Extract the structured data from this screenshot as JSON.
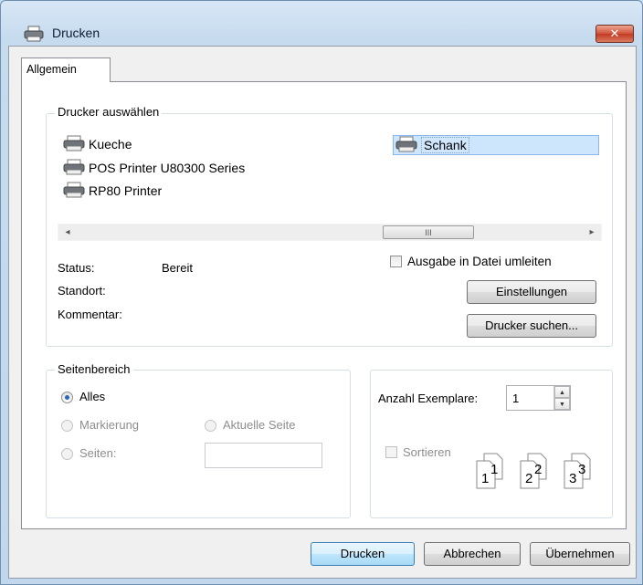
{
  "window": {
    "title": "Drucken",
    "close_label": "✕"
  },
  "tabs": [
    {
      "label": "Allgemein"
    }
  ],
  "printer_select": {
    "label": "Drucker auswählen",
    "printers": [
      {
        "name": "Kueche"
      },
      {
        "name": "POS Printer U80300 Series"
      },
      {
        "name": "RP80 Printer"
      },
      {
        "name": "Schank"
      }
    ],
    "selected": "Schank",
    "scrollbar": {
      "left_arrow": "◂",
      "right_arrow": "▸",
      "thumb": "III"
    }
  },
  "status": {
    "status_label": "Status:",
    "status_value": "Bereit",
    "location_label": "Standort:",
    "comment_label": "Kommentar:",
    "print_to_file_label": "Ausgabe in Datei umleiten",
    "print_to_file_checked": false,
    "settings_button": "Einstellungen",
    "find_printer_button": "Drucker suchen..."
  },
  "page_range": {
    "label": "Seitenbereich",
    "all": "Alles",
    "selection": "Markierung",
    "current_page": "Aktuelle Seite",
    "pages": "Seiten:",
    "selected_option": "Alles",
    "pages_value": ""
  },
  "copies": {
    "label": "Anzahl Exemplare:",
    "value": "1",
    "collate_label": "Sortieren",
    "collate_checked": false,
    "collate_pages": [
      "1",
      "1",
      "2",
      "2",
      "3",
      "3"
    ]
  },
  "footer": {
    "print_button": "Drucken",
    "cancel_button": "Abbrechen",
    "apply_button": "Übernehmen"
  },
  "colors": {
    "selection_bg": "#cde6fb",
    "default_button_border": "#3c7fb1"
  }
}
